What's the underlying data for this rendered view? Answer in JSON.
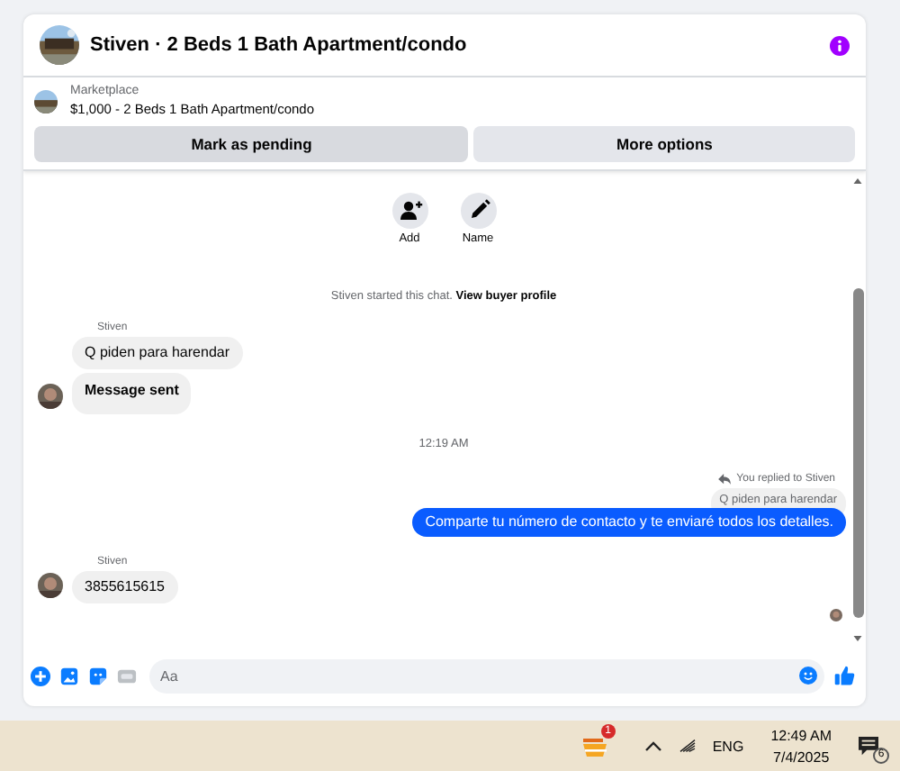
{
  "header": {
    "title": "Stiven · 2 Beds 1 Bath Apartment/condo"
  },
  "listing": {
    "source": "Marketplace",
    "title": "$1,000 - 2 Beds 1 Bath Apartment/condo"
  },
  "listing_buttons": [
    {
      "label": "Mark as pending",
      "selected": true
    },
    {
      "label": "More options",
      "selected": false
    }
  ],
  "chat_actions": [
    {
      "kind": "add",
      "label": "Add"
    },
    {
      "kind": "edit",
      "label": "Name"
    }
  ],
  "intro": {
    "text": "Stiven started this chat.",
    "link": "View buyer profile"
  },
  "messages": [
    {
      "kind": "incoming",
      "sender": "Stiven",
      "bubbles": [
        {
          "text": "Q piden para harendar",
          "bold": false
        },
        {
          "text": "Message sent",
          "bold": true
        }
      ]
    },
    {
      "kind": "time",
      "text": "12:19 AM"
    },
    {
      "kind": "outgoing",
      "reply_note": "You replied to Stiven",
      "quote": "Q piden para harendar",
      "bubbles": [
        {
          "text": "Comparte tu número de contacto y te enviaré todos los detalles.",
          "bold": false
        }
      ]
    },
    {
      "kind": "incoming",
      "sender": "Stiven",
      "bubbles": [
        {
          "text": "3855615615",
          "bold": false
        }
      ]
    }
  ],
  "composer": {
    "placeholder": "Aa"
  },
  "taskbar": {
    "app_badge": "1",
    "language": "ENG",
    "time": "12:49 AM",
    "date": "7/4/2025",
    "notifications": "6"
  }
}
